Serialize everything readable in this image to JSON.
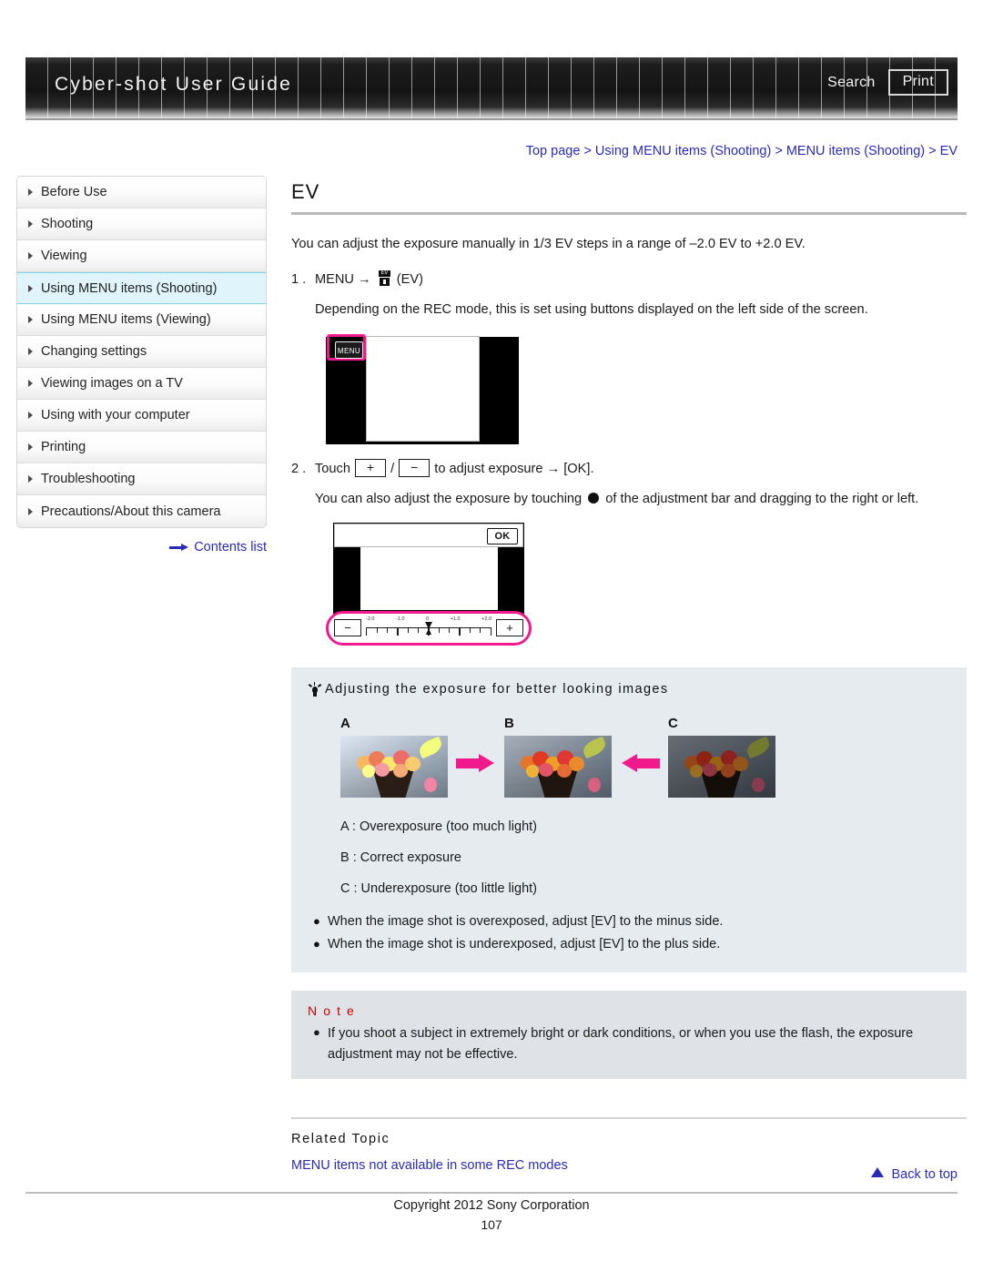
{
  "header": {
    "site_title": "Cyber-shot User Guide",
    "search_label": "Search",
    "print_label": "Print"
  },
  "breadcrumb": {
    "text": "Top page > Using MENU items (Shooting) > MENU items (Shooting) > EV"
  },
  "sidebar": {
    "items": [
      {
        "label": "Before Use"
      },
      {
        "label": "Shooting"
      },
      {
        "label": "Viewing"
      },
      {
        "label": "Using MENU items (Shooting)"
      },
      {
        "label": "Using MENU items (Viewing)"
      },
      {
        "label": "Changing settings"
      },
      {
        "label": "Viewing images on a TV"
      },
      {
        "label": "Using with your computer"
      },
      {
        "label": "Printing"
      },
      {
        "label": "Troubleshooting"
      },
      {
        "label": "Precautions/About this camera"
      }
    ],
    "active_index": 3,
    "contents_link": "Contents list"
  },
  "main": {
    "title": "EV",
    "intro": "You can adjust the exposure manually in 1/3 EV steps in a range of –2.0 EV to +2.0 EV.",
    "step1": {
      "number": "1 .",
      "text_before_icon": "MENU",
      "arrow": "→",
      "icon_label": "EV",
      "text_after_icon": "(EV)",
      "sub": "Depending on the REC mode, this is set using buttons displayed on the left side of the screen."
    },
    "figure1": {
      "menu_key_label": "MENU"
    },
    "step2": {
      "number": "2 .",
      "touch_word": "Touch",
      "plus_key": "+",
      "slash": "/",
      "minus_key": "−",
      "text_mid": "to adjust exposure",
      "arrow": "→",
      "ok_text": "[OK].",
      "sub_part1": "You can also adjust the exposure by touching",
      "sub_part2": "of the adjustment bar and dragging to the right or left."
    },
    "figure2": {
      "ok_label": "OK",
      "minus_label": "−",
      "plus_label": "+",
      "scale_labels": [
        "-2.0",
        "-1.0",
        "0",
        "+1.0",
        "+2.0"
      ]
    },
    "tip": {
      "heading": "Adjusting the exposure for better looking images",
      "photos": [
        {
          "letter": "A"
        },
        {
          "letter": "B"
        },
        {
          "letter": "C"
        }
      ],
      "captions": [
        "A : Overexposure (too much light)",
        "B : Correct exposure",
        "C : Underexposure (too little light)"
      ],
      "bullets": [
        "When the image shot is overexposed, adjust [EV] to the minus side.",
        "When the image shot is underexposed, adjust [EV] to the plus side."
      ],
      "bullet_glyph": "●"
    },
    "note": {
      "title": "N o t e",
      "bullet_glyph": "●",
      "text": "If you shoot a subject in extremely bright or dark conditions, or when you use the flash, the exposure adjustment may not be effective."
    },
    "related": {
      "title": "Related Topic",
      "link": "MENU items not available in some REC modes"
    }
  },
  "footer": {
    "back_to_top": "Back to top",
    "copyright": "Copyright 2012 Sony Corporation",
    "page_number": "107"
  },
  "colors": {
    "link_blue": "#2a2ab8",
    "accent_pink": "#f01a8c",
    "note_red": "#cc0000",
    "active_nav": "#dff5fb"
  }
}
